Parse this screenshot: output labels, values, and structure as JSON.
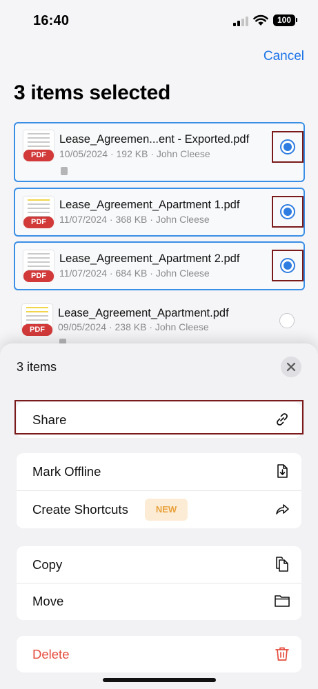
{
  "status": {
    "time": "16:40",
    "battery": "100"
  },
  "header": {
    "cancel_label": "Cancel",
    "title": "3 items selected"
  },
  "files": [
    {
      "name": "Lease_Agreemen...ent - Exported.pdf",
      "meta": "10/05/2024 · 192 KB · John Cleese",
      "badge": "PDF",
      "selected": true
    },
    {
      "name": "Lease_Agreement_Apartment 1.pdf",
      "meta": "11/07/2024 · 368 KB · John Cleese",
      "badge": "PDF",
      "selected": true
    },
    {
      "name": "Lease_Agreement_Apartment 2.pdf",
      "meta": "11/07/2024 · 684 KB · John Cleese",
      "badge": "PDF",
      "selected": true
    },
    {
      "name": "Lease_Agreement_Apartment.pdf",
      "meta": "09/05/2024 · 238 KB · John Cleese",
      "badge": "PDF",
      "selected": false
    }
  ],
  "sheet": {
    "title": "3 items",
    "share_label": "Share",
    "mark_offline_label": "Mark Offline",
    "create_shortcuts_label": "Create Shortcuts",
    "new_badge": "NEW",
    "copy_label": "Copy",
    "move_label": "Move",
    "delete_label": "Delete"
  },
  "icons": {
    "share": "link-icon",
    "mark_offline": "download-doc-icon",
    "create_shortcuts": "share-arrow-icon",
    "copy": "copy-icon",
    "move": "folder-icon",
    "delete": "trash-icon",
    "close": "close-icon"
  },
  "colors": {
    "accent": "#2f7de1",
    "danger": "#e54b3c",
    "badge_pdf": "#d23a3a",
    "new_badge_bg": "#fdecd5",
    "new_badge_fg": "#e8a13b"
  }
}
